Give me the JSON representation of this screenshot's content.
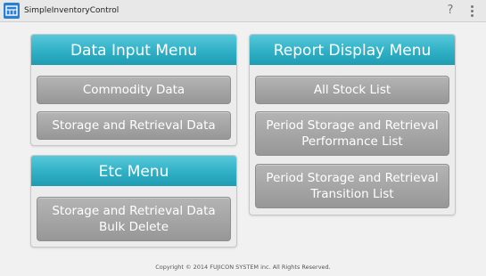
{
  "app": {
    "title": "SimpleInventoryControl",
    "help_glyph": "?",
    "icons": [
      "app-icon",
      "help-icon",
      "overflow-menu-icon"
    ]
  },
  "panels": {
    "data_input": {
      "title": "Data Input Menu",
      "buttons": [
        "Commodity Data",
        "Storage and Retrieval Data"
      ]
    },
    "etc": {
      "title": "Etc Menu",
      "buttons": [
        "Storage and Retrieval Data Bulk Delete"
      ]
    },
    "report": {
      "title": "Report Display Menu",
      "buttons": [
        "All Stock List",
        "Period Storage and Retrieval Performance List",
        "Period Storage and Retrieval Transition List"
      ]
    }
  },
  "footer": {
    "copyright": "Copyright © 2014 FUJICON SYSTEM inc. All Rights Reserved."
  },
  "colors": {
    "header_teal": "#2fb0c6",
    "button_gray": "#a6a6a6",
    "background": "#f1f1f1",
    "app_icon_blue": "#2a7fd0"
  }
}
